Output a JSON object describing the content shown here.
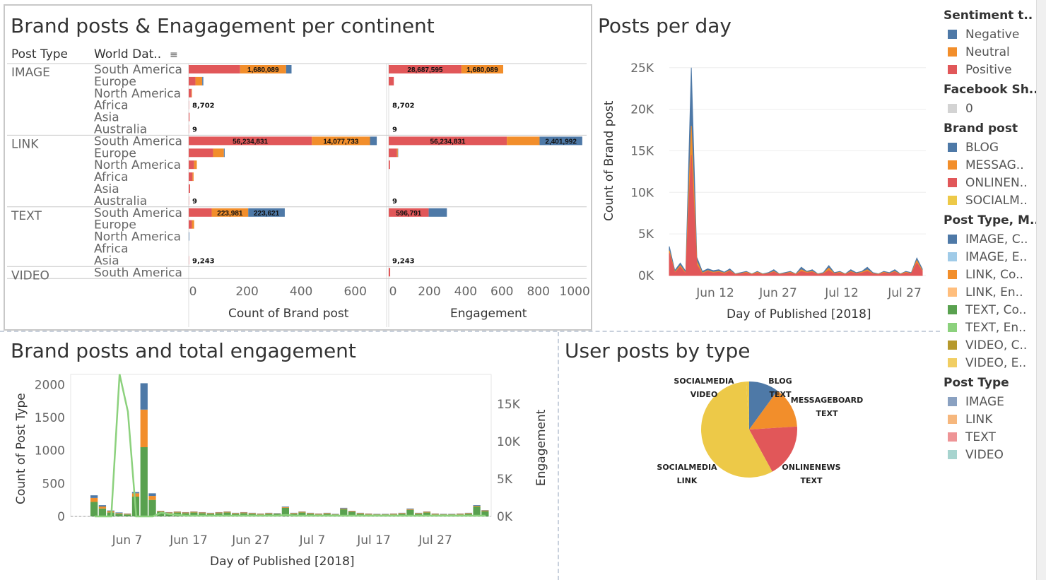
{
  "colors": {
    "negative": "#4e79a7",
    "neutral": "#f28e2b",
    "positive": "#e15759",
    "facebook_zero": "#d3d3d3",
    "blog": "#4e79a7",
    "messageboard": "#f28e2b",
    "onlinenews": "#e15759",
    "socialmedia": "#edc948",
    "image_c": "#4e79a7",
    "image_e": "#a0cbe8",
    "link_c": "#f28e2b",
    "link_e": "#ffbe7d",
    "text_c": "#59a14f",
    "text_e": "#8cd17d",
    "video_c": "#b6992d",
    "video_e": "#f1ce63",
    "pt_image": "#8aa1c1",
    "pt_link": "#f6b77d",
    "pt_text": "#ee9496",
    "pt_video": "#a7d4cf"
  },
  "panel1": {
    "title": "Brand posts & Enagagement per continent",
    "col_post_type": "Post Type",
    "col_world": "World Dat..",
    "x1_title": "Count of Brand post",
    "x2_title": "Engagement"
  },
  "panel2": {
    "title": "Posts per day",
    "ylabel": "Count of Brand post",
    "xlabel": "Day of Published [2018]"
  },
  "panel3": {
    "title": "Brand posts and total engagement",
    "ylabel": "Count of Post Type",
    "y2label": "Engagement",
    "xlabel": "Day of Published [2018]"
  },
  "panel4": {
    "title": "User posts by type"
  },
  "legend": {
    "sentiment": {
      "title": "Sentiment t..",
      "items": [
        "Negative",
        "Neutral",
        "Positive"
      ]
    },
    "facebook": {
      "title": "Facebook Sh..",
      "items": [
        "0"
      ]
    },
    "brandpost": {
      "title": "Brand post",
      "items": [
        "BLOG",
        "MESSAG..",
        "ONLINEN..",
        "SOCIALM.."
      ]
    },
    "posttype_m": {
      "title": "Post Type, M..",
      "items": [
        "IMAGE, C..",
        "IMAGE, E..",
        "LINK, Co..",
        "LINK, En..",
        "TEXT, Co..",
        "TEXT, En..",
        "VIDEO, C..",
        "VIDEO, E.."
      ]
    },
    "posttype": {
      "title": "Post Type",
      "items": [
        "IMAGE",
        "LINK",
        "TEXT",
        "VIDEO"
      ]
    }
  },
  "chart_data": [
    {
      "type": "bar",
      "title": "Brand posts & Enagagement per continent",
      "xlabel": "Count of Brand post",
      "xlim": [
        0,
        700
      ],
      "ticks": [
        "0",
        "200",
        "400",
        "600"
      ],
      "rows": [
        {
          "type": "IMAGE",
          "continent": "South America",
          "pos": 190,
          "neu": 170,
          "neg": 20,
          "labels": {
            "neu": "1,680,089"
          }
        },
        {
          "type": "IMAGE",
          "continent": "Europe",
          "pos": 25,
          "neu": 25,
          "neg": 4
        },
        {
          "type": "IMAGE",
          "continent": "North America",
          "pos": 10,
          "neu": 2,
          "neg": 0
        },
        {
          "type": "IMAGE",
          "continent": "Africa",
          "pos": 1,
          "neu": 0,
          "neg": 0,
          "labels": {
            "out": "8,702"
          }
        },
        {
          "type": "IMAGE",
          "continent": "Asia",
          "pos": 3,
          "neu": 0,
          "neg": 0
        },
        {
          "type": "IMAGE",
          "continent": "Australia",
          "pos": 1,
          "neu": 0,
          "neg": 0,
          "labels": {
            "out": "9"
          }
        },
        {
          "type": "LINK",
          "continent": "South America",
          "pos": 455,
          "neu": 215,
          "neg": 25,
          "labels": {
            "pos": "56,234,831",
            "neu": "14,077,733"
          }
        },
        {
          "type": "LINK",
          "continent": "Europe",
          "pos": 90,
          "neu": 40,
          "neg": 3
        },
        {
          "type": "LINK",
          "continent": "North America",
          "pos": 20,
          "neu": 10,
          "neg": 0
        },
        {
          "type": "LINK",
          "continent": "Africa",
          "pos": 14,
          "neu": 4,
          "neg": 0
        },
        {
          "type": "LINK",
          "continent": "Asia",
          "pos": 5,
          "neu": 0,
          "neg": 0
        },
        {
          "type": "LINK",
          "continent": "Australia",
          "pos": 1,
          "neu": 0,
          "neg": 0,
          "labels": {
            "out": "9"
          }
        },
        {
          "type": "TEXT",
          "continent": "South America",
          "pos": 85,
          "neu": 135,
          "neg": 135,
          "labels": {
            "neu": "223,981",
            "neg": "223,621"
          }
        },
        {
          "type": "TEXT",
          "continent": "Europe",
          "pos": 12,
          "neu": 8,
          "neg": 0
        },
        {
          "type": "TEXT",
          "continent": "North America",
          "pos": 0,
          "neu": 0,
          "neg": 2
        },
        {
          "type": "TEXT",
          "continent": "Africa",
          "pos": 0,
          "neu": 0,
          "neg": 0
        },
        {
          "type": "TEXT",
          "continent": "Asia",
          "pos": 1,
          "neu": 0,
          "neg": 0,
          "labels": {
            "out": "9,243"
          }
        },
        {
          "type": "VIDEO",
          "continent": "South America",
          "pos": 0,
          "neu": 0,
          "neg": 0
        }
      ]
    },
    {
      "type": "bar",
      "xlabel": "Engagement",
      "xlim": [
        0,
        1050
      ],
      "ticks": [
        "0",
        "200",
        "400",
        "600",
        "800",
        "1000"
      ],
      "rows": [
        {
          "pos": 400,
          "neu": 230,
          "neg": 0,
          "labels": {
            "pos": "28,687,595",
            "neu": "1,680,089"
          }
        },
        {
          "pos": 28,
          "neu": 0,
          "neg": 0
        },
        {
          "pos": 0,
          "neu": 0,
          "neg": 0
        },
        {
          "pos": 0,
          "neu": 0,
          "neg": 0,
          "labels": {
            "out": "8,702"
          }
        },
        {
          "pos": 0,
          "neu": 0,
          "neg": 0
        },
        {
          "pos": 0,
          "neu": 0,
          "neg": 0,
          "labels": {
            "out": "9"
          }
        },
        {
          "pos": 650,
          "neu": 180,
          "neg": 235,
          "labels": {
            "pos": "56,234,831",
            "neg": "2,401,992"
          }
        },
        {
          "pos": 45,
          "neu": 5,
          "neg": 2
        },
        {
          "pos": 7,
          "neu": 0,
          "neg": 0
        },
        {
          "pos": 0,
          "neu": 0,
          "neg": 0
        },
        {
          "pos": 0,
          "neu": 0,
          "neg": 0
        },
        {
          "pos": 0,
          "neu": 0,
          "neg": 0,
          "labels": {
            "out": "9"
          }
        },
        {
          "pos": 220,
          "neu": 0,
          "neg": 100,
          "labels": {
            "pos": "596,791"
          }
        },
        {
          "pos": 0,
          "neu": 0,
          "neg": 0
        },
        {
          "pos": 0,
          "neu": 0,
          "neg": 0
        },
        {
          "pos": 0,
          "neu": 0,
          "neg": 0
        },
        {
          "pos": 0,
          "neu": 0,
          "neg": 0,
          "labels": {
            "out": "9,243"
          }
        },
        {
          "pos": 8,
          "neu": 0,
          "neg": 0
        }
      ]
    },
    {
      "type": "area",
      "title": "Posts per day",
      "xlabel": "Day of Published [2018]",
      "ylabel": "Count of Brand post",
      "ylim": [
        0,
        26000
      ],
      "yticks": [
        "0K",
        "5K",
        "10K",
        "15K",
        "20K",
        "25K"
      ],
      "xticks": [
        "Jun 12",
        "Jun 27",
        "Jul 12",
        "Jul 27"
      ],
      "series": [
        {
          "name": "ONLINEN..",
          "values": [
            2700,
            300,
            1000,
            200,
            14500,
            1300,
            200,
            500,
            300,
            400,
            200,
            500,
            100,
            200,
            300,
            100,
            300,
            100,
            200,
            400,
            100,
            200,
            300,
            100,
            500,
            300,
            400,
            100,
            200,
            600,
            200,
            300,
            100,
            400,
            200,
            300,
            500,
            200,
            100,
            300,
            200,
            400,
            100,
            300,
            200,
            1500,
            500
          ]
        },
        {
          "name": "MESSAG..",
          "values": [
            300,
            100,
            200,
            100,
            3500,
            400,
            100,
            100,
            100,
            100,
            100,
            100,
            50,
            50,
            100,
            50,
            100,
            50,
            50,
            100,
            50,
            50,
            100,
            50,
            200,
            100,
            100,
            50,
            50,
            300,
            50,
            100,
            50,
            100,
            50,
            100,
            200,
            50,
            50,
            100,
            50,
            100,
            50,
            100,
            50,
            300,
            100
          ]
        },
        {
          "name": "BLOG",
          "values": [
            500,
            200,
            300,
            200,
            7000,
            500,
            200,
            200,
            200,
            200,
            100,
            200,
            50,
            100,
            100,
            50,
            100,
            50,
            100,
            200,
            50,
            100,
            100,
            50,
            300,
            100,
            200,
            50,
            100,
            300,
            100,
            100,
            50,
            200,
            100,
            100,
            300,
            100,
            50,
            100,
            100,
            200,
            50,
            100,
            100,
            300,
            200
          ]
        }
      ]
    },
    {
      "type": "bar",
      "title": "Brand posts and total engagement",
      "xlabel": "Day of Published [2018]",
      "ylabel": "Count of Post Type",
      "y2label": "Engagement",
      "ylim": [
        0,
        2100
      ],
      "yticks": [
        "0",
        "500",
        "1000",
        "1500",
        "2000"
      ],
      "y2ticks": [
        "0K",
        "5K",
        "10K",
        "15K"
      ],
      "xticks": [
        "Jun 7",
        "Jun 17",
        "Jun 27",
        "Jul 7",
        "Jul 17",
        "Jul 27"
      ],
      "bars": [
        {
          "text": 220,
          "link": 60,
          "image": 40
        },
        {
          "text": 120,
          "link": 30,
          "image": 20
        },
        {
          "text": 60,
          "link": 20,
          "image": 10
        },
        {
          "text": 40,
          "link": 10,
          "image": 10
        },
        {
          "text": 30,
          "link": 10,
          "image": 5
        },
        {
          "text": 300,
          "link": 50,
          "image": 20
        },
        {
          "text": 1050,
          "link": 570,
          "image": 400
        },
        {
          "text": 250,
          "link": 60,
          "image": 40
        },
        {
          "text": 70,
          "link": 10,
          "image": 5
        },
        {
          "text": 50,
          "link": 10,
          "image": 5
        },
        {
          "text": 60,
          "link": 10,
          "image": 5
        },
        {
          "text": 50,
          "link": 10,
          "image": 5
        },
        {
          "text": 60,
          "link": 10,
          "image": 5
        },
        {
          "text": 50,
          "link": 10,
          "image": 5
        },
        {
          "text": 40,
          "link": 10,
          "image": 5
        },
        {
          "text": 50,
          "link": 10,
          "image": 5
        },
        {
          "text": 60,
          "link": 10,
          "image": 5
        },
        {
          "text": 40,
          "link": 10,
          "image": 5
        },
        {
          "text": 50,
          "link": 10,
          "image": 5
        },
        {
          "text": 40,
          "link": 10,
          "image": 5
        },
        {
          "text": 30,
          "link": 10,
          "image": 5
        },
        {
          "text": 40,
          "link": 10,
          "image": 5
        },
        {
          "text": 40,
          "link": 5,
          "image": 5
        },
        {
          "text": 130,
          "link": 10,
          "image": 10
        },
        {
          "text": 40,
          "link": 10,
          "image": 5
        },
        {
          "text": 60,
          "link": 10,
          "image": 5
        },
        {
          "text": 40,
          "link": 10,
          "image": 5
        },
        {
          "text": 30,
          "link": 10,
          "image": 5
        },
        {
          "text": 40,
          "link": 10,
          "image": 5
        },
        {
          "text": 30,
          "link": 5,
          "image": 5
        },
        {
          "text": 110,
          "link": 10,
          "image": 10
        },
        {
          "text": 70,
          "link": 10,
          "image": 5
        },
        {
          "text": 40,
          "link": 10,
          "image": 5
        },
        {
          "text": 30,
          "link": 10,
          "image": 5
        },
        {
          "text": 30,
          "link": 5,
          "image": 5
        },
        {
          "text": 30,
          "link": 5,
          "image": 5
        },
        {
          "text": 30,
          "link": 10,
          "image": 5
        },
        {
          "text": 40,
          "link": 10,
          "image": 5
        },
        {
          "text": 100,
          "link": 10,
          "image": 10
        },
        {
          "text": 40,
          "link": 10,
          "image": 5
        },
        {
          "text": 60,
          "link": 10,
          "image": 5
        },
        {
          "text": 30,
          "link": 10,
          "image": 5
        },
        {
          "text": 30,
          "link": 5,
          "image": 5
        },
        {
          "text": 30,
          "link": 5,
          "image": 5
        },
        {
          "text": 30,
          "link": 10,
          "image": 5
        },
        {
          "text": 40,
          "link": 10,
          "image": 5
        },
        {
          "text": 150,
          "link": 10,
          "image": 10
        },
        {
          "text": 80,
          "link": 10,
          "image": 5
        }
      ],
      "engagement_line": [
        0,
        0,
        0,
        19000,
        14000,
        0,
        0,
        0,
        500,
        300,
        200,
        100,
        100,
        100,
        100,
        100,
        100,
        100,
        100,
        100,
        100,
        100,
        100,
        200,
        100,
        100,
        100,
        100,
        100,
        100,
        100,
        100,
        100,
        100,
        100,
        100,
        100,
        100,
        100,
        100,
        100,
        100,
        100,
        100,
        100,
        100,
        100,
        100
      ]
    },
    {
      "type": "pie",
      "title": "User posts by type",
      "slices": [
        {
          "label": "BLOG TEXT",
          "value": 10,
          "color_key": "blog"
        },
        {
          "label": "MESSAGEBOARD TEXT",
          "value": 14,
          "color_key": "messageboard"
        },
        {
          "label": "ONLINENEWS TEXT",
          "value": 18,
          "color_key": "onlinenews"
        },
        {
          "label": "SOCIALMEDIA LINK",
          "value": 57,
          "color_key": "socialmedia"
        },
        {
          "label": "SOCIALMEDIA VIDEO",
          "value": 1,
          "color_key": "socialmedia"
        }
      ]
    }
  ]
}
